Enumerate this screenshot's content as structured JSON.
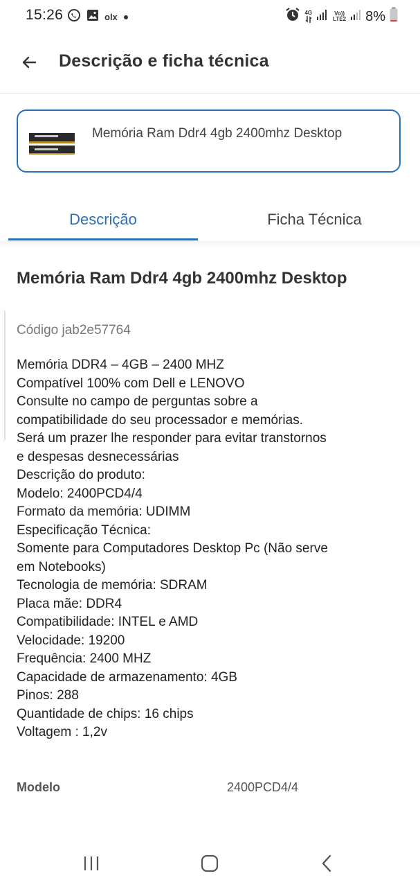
{
  "status_bar": {
    "time": "15:26",
    "left_icons": [
      "whatsapp-icon",
      "gallery-icon",
      "olx-icon",
      "dot-icon"
    ],
    "olx_label": "olx",
    "right_icons": [
      "alarm-icon",
      "data-4g-icon",
      "signal-icon",
      "volte-icon",
      "signal-icon",
      "battery-icon"
    ],
    "network_4g": "4G",
    "volte_top": "Vo))",
    "volte_bottom": "LTE2",
    "battery": "8%"
  },
  "app_bar": {
    "back_icon": "arrow-left-icon",
    "title": "Descrição e ficha técnica"
  },
  "product_card": {
    "title": "Memória Ram Ddr4 4gb 2400mhz Desktop",
    "thumbnail": "ram-module-image"
  },
  "tabs": {
    "items": [
      {
        "label": "Descrição",
        "selected": true
      },
      {
        "label": "Ficha Técnica",
        "selected": false
      }
    ],
    "accent_color": "#2b6fb6"
  },
  "content": {
    "title": "Memória Ram Ddr4 4gb 2400mhz Desktop",
    "code": "Código jab2e57764",
    "description_lines": [
      "Memória DDR4 – 4GB – 2400 MHZ",
      "Compatível 100% com Dell e LENOVO",
      "Consulte no campo de perguntas sobre a",
      "compatibilidade do seu processador e memórias.",
      "Será um prazer lhe responder para evitar transtornos",
      "e despesas desnecessárias",
      "Descrição do produto:",
      "Modelo: 2400PCD4/4",
      "Formato da memória: UDIMM",
      "Especificação Técnica:",
      "Somente para Computadores Desktop Pc (Não serve",
      "em Notebooks)",
      "Tecnologia de memória: SDRAM",
      "Placa mãe: DDR4",
      "Compatibilidade: INTEL e AMD",
      "Velocidade: 19200",
      "Frequência: 2400 MHZ",
      "Capacidade de armazenamento: 4GB",
      "Pinos: 288",
      "Quantidade de chips: 16 chips",
      "Voltagem : 1,2v"
    ],
    "spec": {
      "key": "Modelo",
      "value": "2400PCD4/4"
    }
  },
  "nav_bar": {
    "items": [
      "recent-apps-icon",
      "home-icon",
      "back-icon"
    ]
  }
}
